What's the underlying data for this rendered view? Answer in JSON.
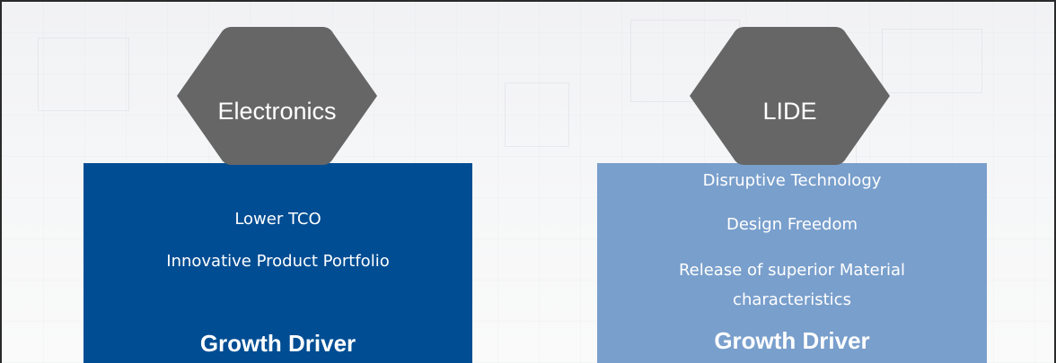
{
  "colors": {
    "left_panel": "#004d93",
    "right_panel": "#799fcc",
    "hexagon": "#666666",
    "text": "#ffffff"
  },
  "left": {
    "hex_label": "Electronics",
    "items": [
      "Lower TCO",
      "Innovative Product Portfolio"
    ],
    "footer": "Growth Driver"
  },
  "right": {
    "hex_label": "LIDE",
    "items": [
      "Disruptive Technology",
      "Design Freedom",
      "Release of superior Material",
      "characteristics"
    ],
    "footer": "Growth Driver"
  }
}
